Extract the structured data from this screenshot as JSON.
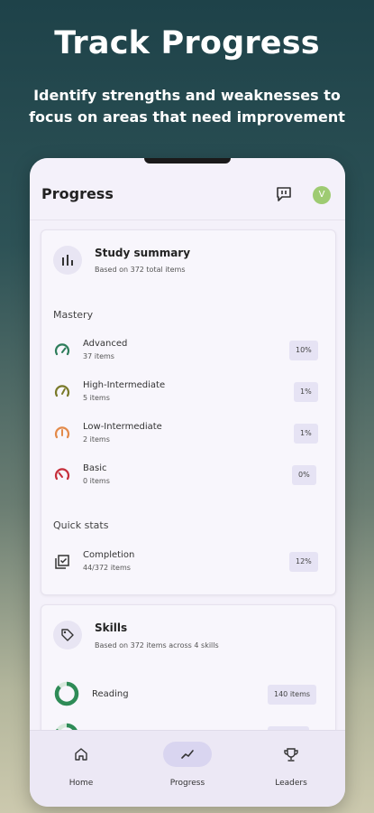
{
  "hero": {
    "title": "Track Progress",
    "subtitle": "Identify strengths and weaknesses to focus on areas that need improvement"
  },
  "app_bar": {
    "title": "Progress",
    "avatar_initial": "V",
    "avatar_color": "#9ecb72"
  },
  "study_summary": {
    "title": "Study summary",
    "subtitle": "Based on 372 total items",
    "icon": "bar-chart-icon",
    "mastery_label": "Mastery",
    "mastery": [
      {
        "label": "Advanced",
        "count": "37 items",
        "percent": "10%",
        "icon": "gauge-advanced-icon",
        "color": "#2e7d5b"
      },
      {
        "label": "High-Intermediate",
        "count": "5 items",
        "percent": "1%",
        "icon": "gauge-high-intermediate-icon",
        "color": "#7a7a2a"
      },
      {
        "label": "Low-Intermediate",
        "count": "2 items",
        "percent": "1%",
        "icon": "gauge-low-intermediate-icon",
        "color": "#e38a4a"
      },
      {
        "label": "Basic",
        "count": "0 items",
        "percent": "0%",
        "icon": "gauge-basic-icon",
        "color": "#c62f3b"
      }
    ],
    "quick_stats_label": "Quick stats",
    "quick_stats": [
      {
        "label": "Completion",
        "count": "44/372 items",
        "percent": "12%",
        "icon": "checklist-icon"
      }
    ]
  },
  "skills": {
    "title": "Skills",
    "subtitle": "Based on 372 items across 4 skills",
    "icon": "tag-icon",
    "items": [
      {
        "label": "Reading",
        "count": "140 items",
        "icon": "donut-progress-icon",
        "color": "#2e8b57"
      }
    ]
  },
  "bottom_nav": [
    {
      "label": "Home",
      "icon": "home-icon",
      "active": false
    },
    {
      "label": "Progress",
      "icon": "trend-icon",
      "active": true
    },
    {
      "label": "Leaders",
      "icon": "trophy-icon",
      "active": false
    }
  ],
  "colors": {
    "accent_active_pill": "#d9d5f0",
    "pill_background": "#e6e3f4"
  }
}
